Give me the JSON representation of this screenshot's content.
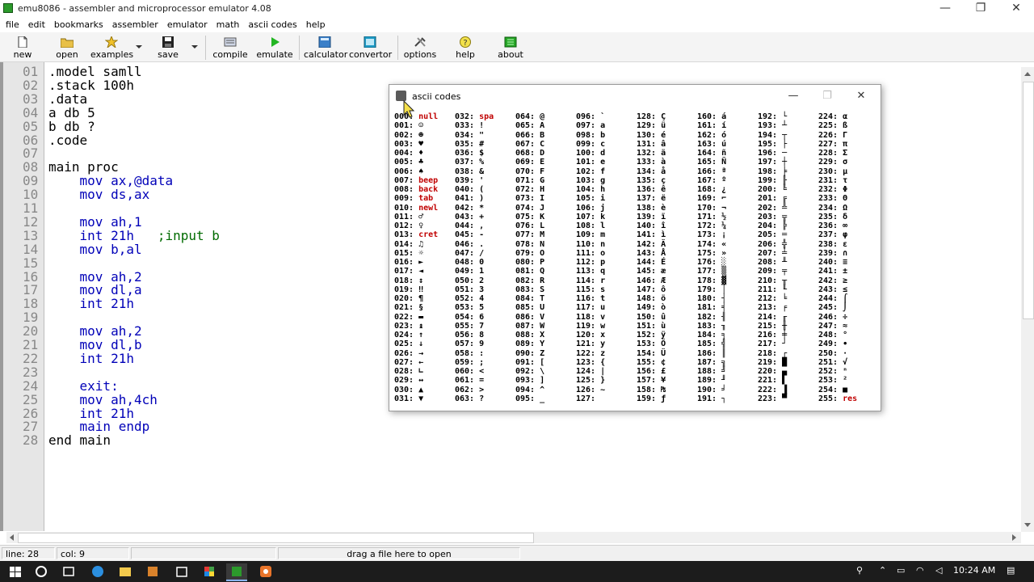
{
  "window": {
    "title": "emu8086 - assembler and microprocessor emulator 4.08",
    "minimize": "—",
    "maximize": "❐",
    "close": "✕"
  },
  "menu": [
    "file",
    "edit",
    "bookmarks",
    "assembler",
    "emulator",
    "math",
    "ascii codes",
    "help"
  ],
  "toolbar": [
    {
      "label": "new",
      "icon": "new-file-icon"
    },
    {
      "label": "open",
      "icon": "open-folder-icon"
    },
    {
      "label": "examples",
      "icon": "examples-star-icon"
    },
    {
      "label": "save",
      "icon": "save-disk-icon"
    },
    {
      "label": "compile",
      "icon": "compile-icon"
    },
    {
      "label": "emulate",
      "icon": "emulate-play-icon"
    },
    {
      "label": "calculator",
      "icon": "calculator-icon"
    },
    {
      "label": "convertor",
      "icon": "convertor-icon"
    },
    {
      "label": "options",
      "icon": "options-tools-icon"
    },
    {
      "label": "help",
      "icon": "help-icon"
    },
    {
      "label": "about",
      "icon": "about-icon"
    }
  ],
  "editor": {
    "line_numbers": [
      "01",
      "02",
      "03",
      "04",
      "05",
      "06",
      "07",
      "08",
      "09",
      "10",
      "11",
      "12",
      "13",
      "14",
      "15",
      "16",
      "17",
      "18",
      "19",
      "20",
      "21",
      "22",
      "23",
      "24",
      "25",
      "26",
      "27",
      "28"
    ],
    "lines": [
      {
        "text": ".model samll",
        "cls": "dir"
      },
      {
        "text": ".stack 100h",
        "cls": "dir"
      },
      {
        "text": ".data",
        "cls": "dir"
      },
      {
        "text": "a db 5",
        "cls": "dir"
      },
      {
        "text": "b db ?",
        "cls": "dir"
      },
      {
        "text": ".code",
        "cls": "dir"
      },
      {
        "text": "",
        "cls": "dir"
      },
      {
        "text": "main proc",
        "cls": "dir"
      },
      {
        "text": "    mov ax,@data",
        "cls": "kw"
      },
      {
        "text": "    mov ds,ax",
        "cls": "kw"
      },
      {
        "text": "",
        "cls": "dir"
      },
      {
        "text": "    mov ah,1",
        "cls": "kw"
      },
      {
        "text": "    int 21h",
        "cls": "kw",
        "comment": "   ;input b"
      },
      {
        "text": "    mov b,al",
        "cls": "kw"
      },
      {
        "text": "",
        "cls": "dir"
      },
      {
        "text": "    mov ah,2",
        "cls": "kw"
      },
      {
        "text": "    mov dl,a",
        "cls": "kw"
      },
      {
        "text": "    int 21h",
        "cls": "kw"
      },
      {
        "text": "",
        "cls": "dir"
      },
      {
        "text": "    mov ah,2",
        "cls": "kw"
      },
      {
        "text": "    mov dl,b",
        "cls": "kw"
      },
      {
        "text": "    int 21h",
        "cls": "kw"
      },
      {
        "text": "",
        "cls": "dir"
      },
      {
        "text": "    exit:",
        "cls": "kw"
      },
      {
        "text": "    mov ah,4ch",
        "cls": "kw"
      },
      {
        "text": "    int 21h",
        "cls": "kw"
      },
      {
        "text": "    main endp",
        "cls": "kw"
      },
      {
        "text": "end main",
        "cls": "dir"
      }
    ]
  },
  "status": {
    "line": "line: 28",
    "col": "col: 9",
    "drop_hint": "drag a file here to open"
  },
  "ascii_window": {
    "title": "ascii codes",
    "special": {
      "0": "null",
      "32": "spa",
      "7": "beep",
      "8": "back",
      "9": "tab",
      "10": "newl",
      "13": "cret",
      "255": "res"
    },
    "chars": "☺☻♥♦♣♠•◘○◙♂♀♪♫☼►◄↕‼¶§▬↨↑↓→←∟↔▲▼",
    "high": "ÇüéâäàåçêëèïîìÄÅÉæÆôöòûùÿÖÜ¢£¥₧ƒáíóúñÑªº¿⌐¬½¼¡«»░▒▓│┤╡╢╖╕╣║╗╝╜╛┐└┴┬├─┼╞╟╚╔╩╦╠═╬╧╨╤╥╙╘╒╓╫╪┘┌█▄▌▐▀αßΓπΣσµτΦΘΩδ∞φε∩≡±≥≤⌠⌡÷≈°∙·√ⁿ²■"
  },
  "taskbar": {
    "time": "10:24 AM"
  }
}
